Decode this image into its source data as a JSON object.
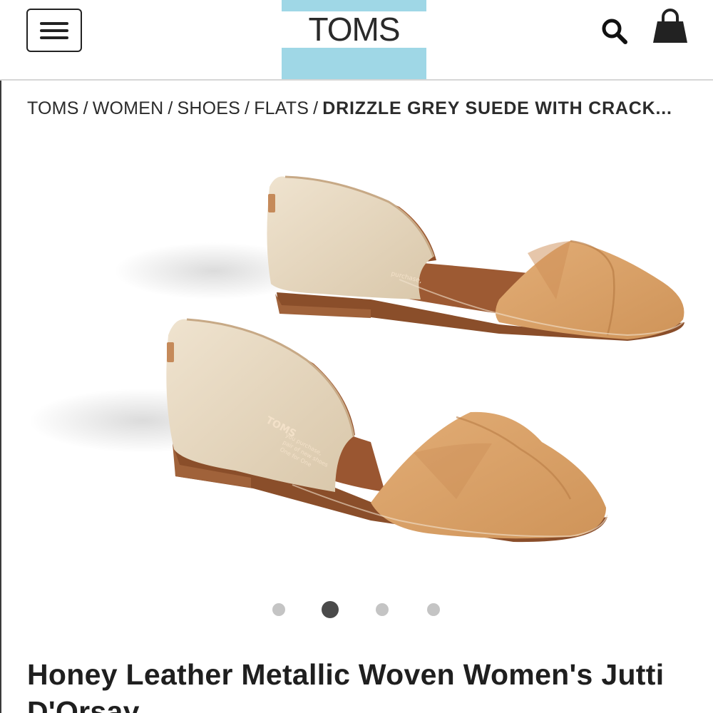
{
  "header": {
    "menu_icon": "hamburger-menu-icon",
    "logo_text": "TOMS",
    "search_icon": "search-icon",
    "cart_icon": "shopping-bag-icon",
    "brand_color": "#9fd7e6"
  },
  "breadcrumb": {
    "items": [
      "TOMS",
      "WOMEN",
      "SHOES",
      "FLATS"
    ],
    "separator": "/",
    "current": "DRIZZLE GREY SUEDE WITH CRACK..."
  },
  "product": {
    "image_icon": "product-photo-shoes",
    "insole_text": "TOMS",
    "carousel": {
      "count": 4,
      "active_index": 1
    },
    "title": "Honey Leather Metallic Woven Women's Jutti D'Orsay"
  }
}
